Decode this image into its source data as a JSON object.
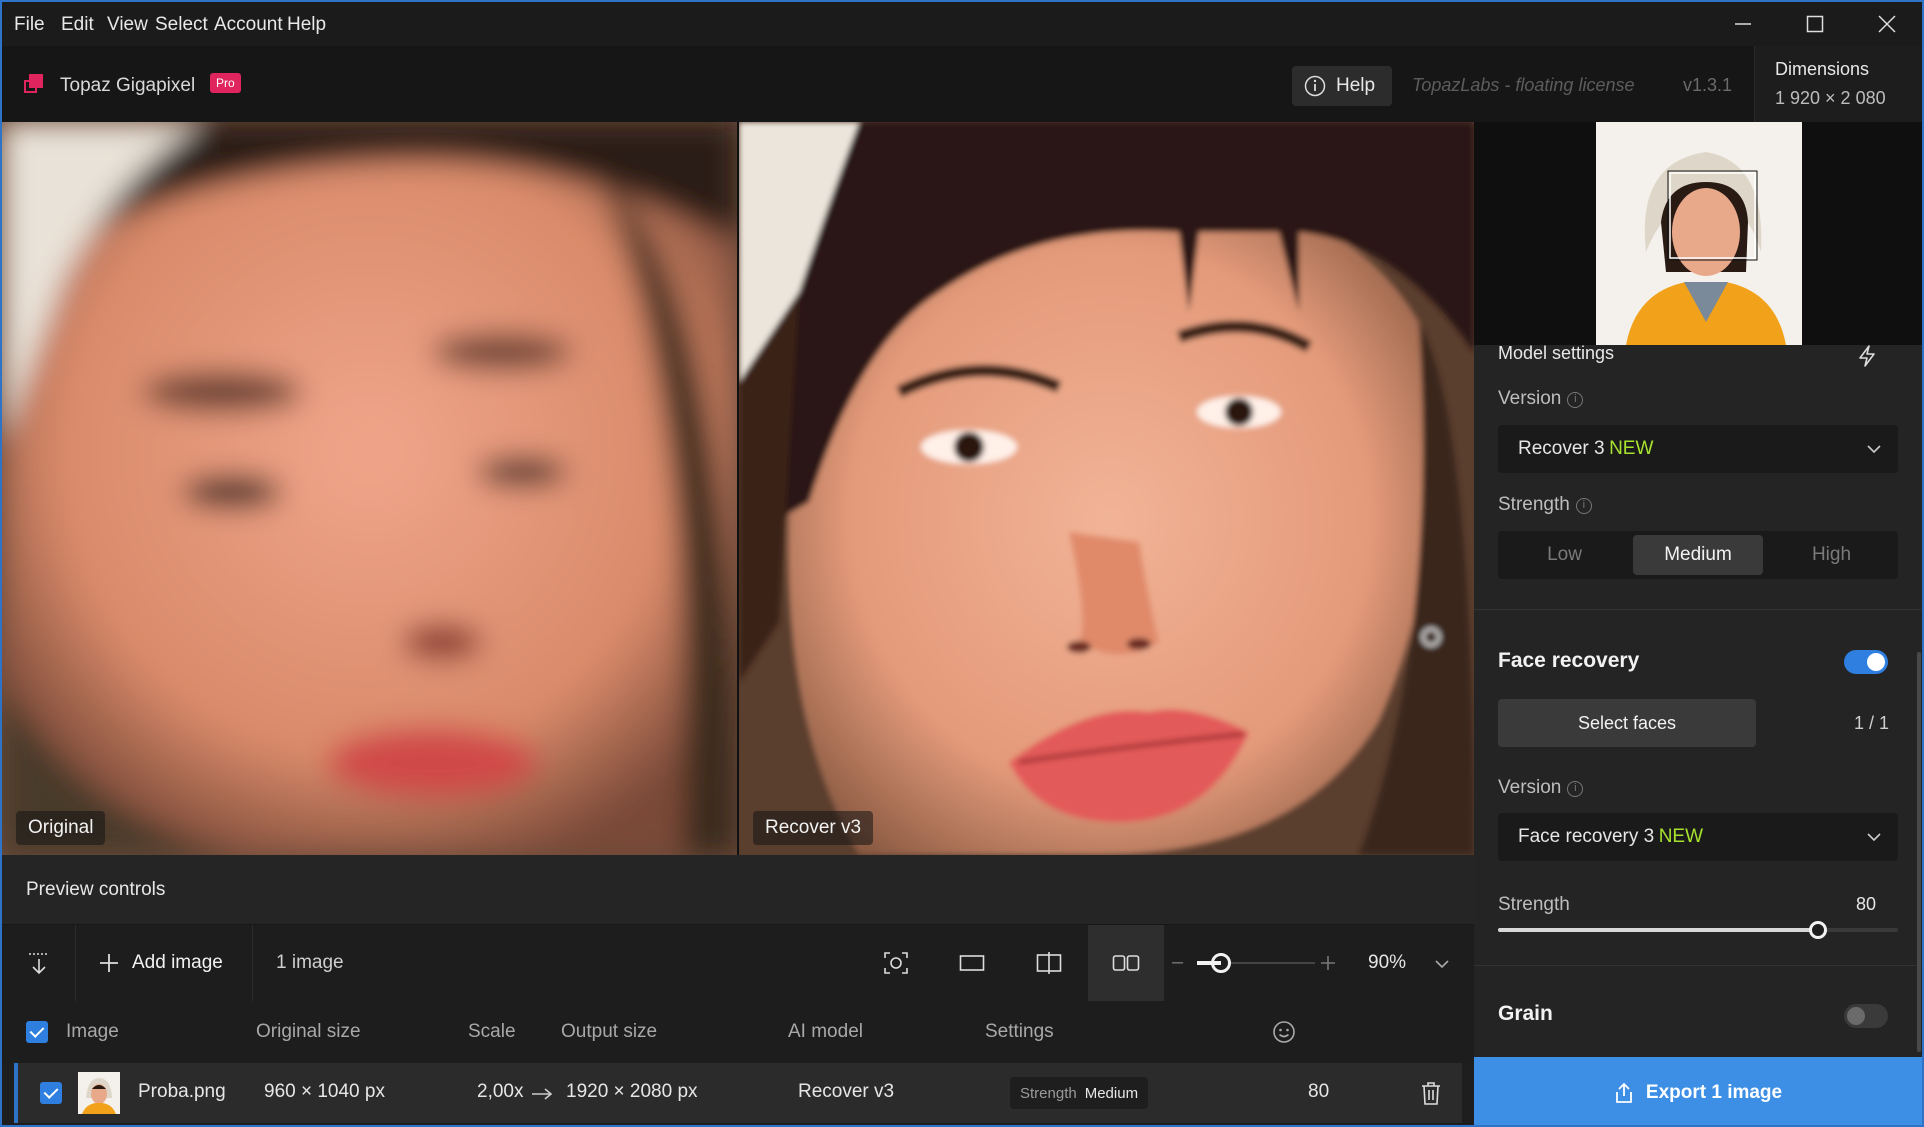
{
  "menu": [
    "File",
    "Edit",
    "View",
    "Select",
    "Account",
    "Help"
  ],
  "app": {
    "name": "Topaz Gigapixel",
    "badge": "Pro"
  },
  "header": {
    "help_label": "Help",
    "license": "TopazLabs - floating license",
    "version": "v1.3.1"
  },
  "dimensions": {
    "title": "Dimensions",
    "value": "1 920 × 2 080"
  },
  "preview": {
    "left_caption": "Original",
    "right_caption": "Recover v3"
  },
  "model_settings": {
    "title": "Model settings",
    "version_label": "Version",
    "version_value": "Recover 3",
    "version_tag": "NEW",
    "strength_label": "Strength",
    "strength_options": [
      "Low",
      "Medium",
      "High"
    ],
    "strength_selected": "Medium"
  },
  "face_recovery": {
    "title": "Face recovery",
    "enabled": true,
    "select_faces_label": "Select faces",
    "faces_count": "1 / 1",
    "version_label": "Version",
    "version_value": "Face recovery 3",
    "version_tag": "NEW",
    "strength_label": "Strength",
    "strength_value": "80",
    "strength_fraction": 0.8
  },
  "grain": {
    "title": "Grain",
    "enabled": false
  },
  "export": {
    "label": "Export 1 image"
  },
  "preview_controls": {
    "label": "Preview controls"
  },
  "toolbar": {
    "add_image_label": "Add image",
    "image_count": "1 image",
    "zoom": "90%",
    "zoom_fraction": 0.2
  },
  "table": {
    "headers": {
      "image": "Image",
      "original_size": "Original size",
      "scale": "Scale",
      "output_size": "Output size",
      "ai_model": "AI model",
      "settings": "Settings"
    },
    "rows": [
      {
        "name": "Proba.png",
        "original_size": "960 × 1040 px",
        "scale": "2,00x",
        "output_size": "1920 × 2080 px",
        "ai_model": "Recover v3",
        "settings_key": "Strength",
        "settings_value": "Medium",
        "face_value": "80"
      }
    ]
  },
  "colors": {
    "accent": "#2d73c7",
    "new_tag": "#a6e22e",
    "badge": "#e0245e",
    "export_bg": "#3d8fe6"
  }
}
